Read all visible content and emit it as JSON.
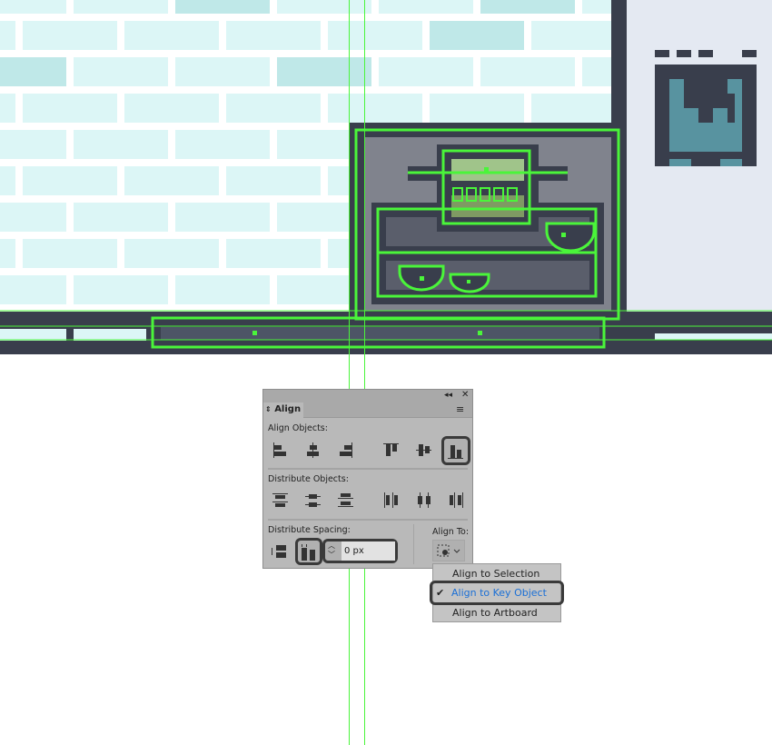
{
  "colors": {
    "selection": "#4af53a",
    "dark": "#393e4c",
    "brick": "#dcf6f6",
    "screen": "#a0c48a",
    "accent_blue": "#1a6fd6",
    "icon_teal": "#5893a0"
  },
  "panel": {
    "title": "Align",
    "collapse_icon": "double-chevron-left-icon",
    "close_icon": "close-icon",
    "menu_icon": "hamburger-icon",
    "align_objects_label": "Align Objects:",
    "align_objects": [
      "horizontal-align-left",
      "horizontal-align-center",
      "horizontal-align-right",
      "vertical-align-top",
      "vertical-align-center",
      "vertical-align-bottom"
    ],
    "align_objects_active": "vertical-align-bottom",
    "distribute_objects_label": "Distribute Objects:",
    "distribute_objects": [
      "vertical-distribute-top",
      "vertical-distribute-center",
      "vertical-distribute-bottom",
      "horizontal-distribute-left",
      "horizontal-distribute-center",
      "horizontal-distribute-right"
    ],
    "distribute_spacing_label": "Distribute Spacing:",
    "distribute_spacing": [
      "vertical-distribute-space",
      "horizontal-distribute-space"
    ],
    "distribute_spacing_active": "horizontal-distribute-space",
    "spacing_value": "0 px",
    "align_to_label": "Align To:"
  },
  "align_to_menu": {
    "items": [
      {
        "label": "Align to Selection",
        "checked": false
      },
      {
        "label": "Align to Key Object",
        "checked": true
      },
      {
        "label": "Align to Artboard",
        "checked": false
      }
    ],
    "check": "✔"
  }
}
